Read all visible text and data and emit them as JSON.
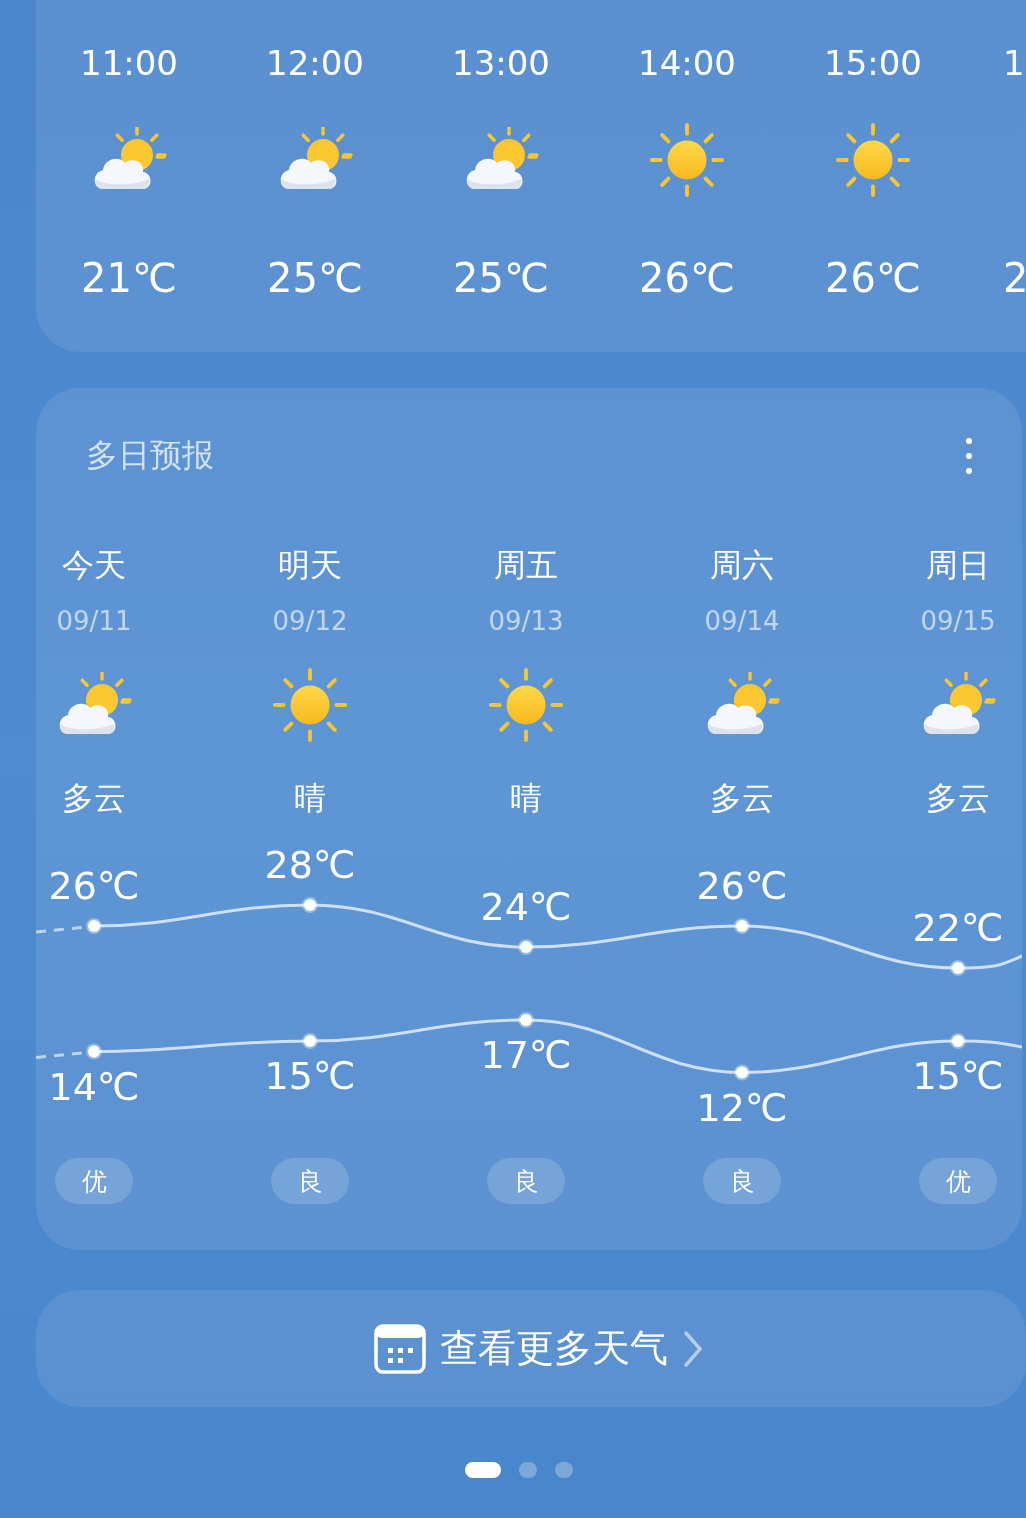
{
  "hourly": [
    {
      "time": "11:00",
      "kind": "partly_cloudy",
      "temp": "21℃"
    },
    {
      "time": "12:00",
      "kind": "partly_cloudy",
      "temp": "25℃"
    },
    {
      "time": "13:00",
      "kind": "partly_cloudy",
      "temp": "25℃"
    },
    {
      "time": "14:00",
      "kind": "sunny",
      "temp": "26℃"
    },
    {
      "time": "15:00",
      "kind": "sunny",
      "temp": "26℃"
    },
    {
      "time": "1",
      "temp": "2"
    }
  ],
  "daily": {
    "title": "多日预报",
    "days": [
      {
        "name": "今天",
        "date": "09/11",
        "kind": "partly_cloudy",
        "condition": "多云",
        "high": "26℃",
        "low": "14℃",
        "air": "优"
      },
      {
        "name": "明天",
        "date": "09/12",
        "kind": "sunny",
        "condition": "晴",
        "high": "28℃",
        "low": "15℃",
        "air": "良"
      },
      {
        "name": "周五",
        "date": "09/13",
        "kind": "sunny",
        "condition": "晴",
        "high": "24℃",
        "low": "17℃",
        "air": "良"
      },
      {
        "name": "周六",
        "date": "09/14",
        "kind": "partly_cloudy",
        "condition": "多云",
        "high": "26℃",
        "low": "12℃",
        "air": "良"
      },
      {
        "name": "周日",
        "date": "09/15",
        "kind": "partly_cloudy",
        "condition": "多云",
        "high": "22℃",
        "low": "15℃",
        "air": "优"
      }
    ]
  },
  "more_button": {
    "label": "查看更多天气"
  },
  "pages": [
    {
      "selected": true
    },
    {
      "selected": false
    },
    {
      "selected": false
    }
  ]
}
